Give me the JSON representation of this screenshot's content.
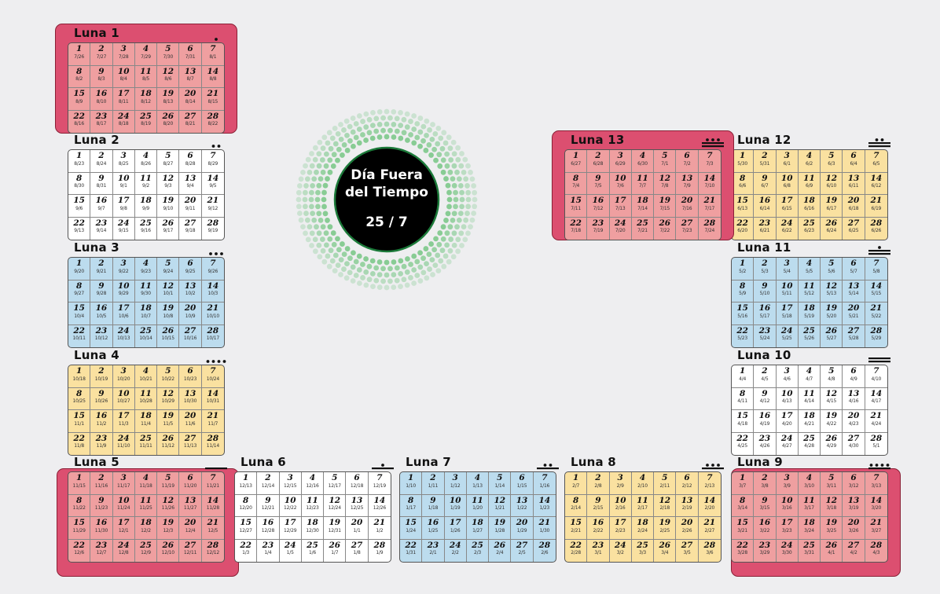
{
  "day_out_of_time": {
    "line1": "Día Fuera",
    "line2": "del Tiempo",
    "date": "25 / 7",
    "ring_color": "#7cc88a"
  },
  "moons": [
    {
      "name": "Luna 1",
      "dots": 1,
      "bars": 0,
      "color": "#ef9fa0",
      "greg": [
        "7/26",
        "7/27",
        "7/28",
        "7/29",
        "7/30",
        "7/31",
        "8/1",
        "8/2",
        "8/3",
        "8/4",
        "8/5",
        "8/6",
        "8/7",
        "8/8",
        "8/9",
        "8/10",
        "8/11",
        "8/12",
        "8/13",
        "8/14",
        "8/15",
        "8/16",
        "8/17",
        "8/18",
        "8/19",
        "8/20",
        "8/21",
        "8/22"
      ]
    },
    {
      "name": "Luna 2",
      "dots": 2,
      "bars": 0,
      "color": "#ffffff",
      "greg": [
        "8/23",
        "8/24",
        "8/25",
        "8/26",
        "8/27",
        "8/28",
        "8/29",
        "8/30",
        "8/31",
        "9/1",
        "9/2",
        "9/3",
        "9/4",
        "9/5",
        "9/6",
        "9/7",
        "9/8",
        "9/9",
        "9/10",
        "9/11",
        "9/12",
        "9/13",
        "9/14",
        "9/15",
        "9/16",
        "9/17",
        "9/18",
        "9/19"
      ]
    },
    {
      "name": "Luna 3",
      "dots": 3,
      "bars": 0,
      "color": "#bcdcee",
      "greg": [
        "9/20",
        "9/21",
        "9/22",
        "9/23",
        "9/24",
        "9/25",
        "9/26",
        "9/27",
        "9/28",
        "9/29",
        "9/30",
        "10/1",
        "10/2",
        "10/3",
        "10/4",
        "10/5",
        "10/6",
        "10/7",
        "10/8",
        "10/9",
        "10/10",
        "10/11",
        "10/12",
        "10/13",
        "10/14",
        "10/15",
        "10/16",
        "10/17"
      ]
    },
    {
      "name": "Luna 4",
      "dots": 4,
      "bars": 0,
      "color": "#fae1a0",
      "greg": [
        "10/18",
        "10/19",
        "10/20",
        "10/21",
        "10/22",
        "10/23",
        "10/24",
        "10/25",
        "10/26",
        "10/27",
        "10/28",
        "10/29",
        "10/30",
        "10/31",
        "11/1",
        "11/2",
        "11/3",
        "11/4",
        "11/5",
        "11/6",
        "11/7",
        "11/8",
        "11/9",
        "11/10",
        "11/11",
        "11/12",
        "11/13",
        "11/14"
      ]
    },
    {
      "name": "Luna 5",
      "dots": 0,
      "bars": 1,
      "color": "#ef9fa0",
      "greg": [
        "11/15",
        "11/16",
        "11/17",
        "11/18",
        "11/19",
        "11/20",
        "11/21",
        "11/22",
        "11/23",
        "11/24",
        "11/25",
        "11/26",
        "11/27",
        "11/28",
        "11/29",
        "11/30",
        "12/1",
        "12/2",
        "12/3",
        "12/4",
        "12/5",
        "12/6",
        "12/7",
        "12/8",
        "12/9",
        "12/10",
        "12/11",
        "12/12"
      ]
    },
    {
      "name": "Luna 6",
      "dots": 1,
      "bars": 1,
      "color": "#ffffff",
      "greg": [
        "12/13",
        "12/14",
        "12/15",
        "12/16",
        "12/17",
        "12/18",
        "12/19",
        "12/20",
        "12/21",
        "12/22",
        "12/23",
        "12/24",
        "12/25",
        "12/26",
        "12/27",
        "12/28",
        "12/29",
        "12/30",
        "12/31",
        "1/1",
        "1/2",
        "1/3",
        "1/4",
        "1/5",
        "1/6",
        "1/7",
        "1/8",
        "1/9"
      ]
    },
    {
      "name": "Luna 7",
      "dots": 2,
      "bars": 1,
      "color": "#bcdcee",
      "greg": [
        "1/10",
        "1/11",
        "1/12",
        "1/13",
        "1/14",
        "1/15",
        "1/16",
        "1/17",
        "1/18",
        "1/19",
        "1/20",
        "1/21",
        "1/22",
        "1/23",
        "1/24",
        "1/25",
        "1/26",
        "1/27",
        "1/28",
        "1/29",
        "1/30",
        "1/31",
        "2/1",
        "2/2",
        "2/3",
        "2/4",
        "2/5",
        "2/6"
      ]
    },
    {
      "name": "Luna 8",
      "dots": 3,
      "bars": 1,
      "color": "#fae1a0",
      "greg": [
        "2/7",
        "2/8",
        "2/9",
        "2/10",
        "2/11",
        "2/12",
        "2/13",
        "2/14",
        "2/15",
        "2/16",
        "2/17",
        "2/18",
        "2/19",
        "2/20",
        "2/21",
        "2/22",
        "2/23",
        "2/24",
        "2/25",
        "2/26",
        "2/27",
        "2/28",
        "3/1",
        "3/2",
        "3/3",
        "3/4",
        "3/5",
        "3/6"
      ]
    },
    {
      "name": "Luna 9",
      "dots": 4,
      "bars": 1,
      "color": "#ef9fa0",
      "greg": [
        "3/7",
        "3/8",
        "3/9",
        "3/10",
        "3/11",
        "3/12",
        "3/13",
        "3/14",
        "3/15",
        "3/16",
        "3/17",
        "3/18",
        "3/19",
        "3/20",
        "3/21",
        "3/22",
        "3/23",
        "3/24",
        "3/25",
        "3/26",
        "3/27",
        "3/28",
        "3/29",
        "3/30",
        "3/31",
        "4/1",
        "4/2",
        "4/3"
      ]
    },
    {
      "name": "Luna 10",
      "dots": 0,
      "bars": 2,
      "color": "#ffffff",
      "greg": [
        "4/4",
        "4/5",
        "4/6",
        "4/7",
        "4/8",
        "4/9",
        "4/10",
        "4/11",
        "4/12",
        "4/13",
        "4/14",
        "4/15",
        "4/16",
        "4/17",
        "4/18",
        "4/19",
        "4/20",
        "4/21",
        "4/22",
        "4/23",
        "4/24",
        "4/25",
        "4/26",
        "4/27",
        "4/28",
        "4/29",
        "4/30",
        "5/1"
      ]
    },
    {
      "name": "Luna 11",
      "dots": 1,
      "bars": 2,
      "color": "#bcdcee",
      "greg": [
        "5/2",
        "5/3",
        "5/4",
        "5/5",
        "5/6",
        "5/7",
        "5/8",
        "5/9",
        "5/10",
        "5/11",
        "5/12",
        "5/13",
        "5/14",
        "5/15",
        "5/16",
        "5/17",
        "5/18",
        "5/19",
        "5/20",
        "5/21",
        "5/22",
        "5/23",
        "5/24",
        "5/25",
        "5/26",
        "5/27",
        "5/28",
        "5/29"
      ]
    },
    {
      "name": "Luna 12",
      "dots": 2,
      "bars": 2,
      "color": "#fae1a0",
      "greg": [
        "5/30",
        "5/31",
        "6/1",
        "6/2",
        "6/3",
        "6/4",
        "6/5",
        "6/6",
        "6/7",
        "6/8",
        "6/9",
        "6/10",
        "6/11",
        "6/12",
        "6/13",
        "6/14",
        "6/15",
        "6/16",
        "6/17",
        "6/18",
        "6/19",
        "6/20",
        "6/21",
        "6/22",
        "6/23",
        "6/24",
        "6/25",
        "6/26"
      ]
    },
    {
      "name": "Luna 13",
      "dots": 3,
      "bars": 2,
      "color": "#ef9fa0",
      "greg": [
        "6/27",
        "6/28",
        "6/29",
        "6/30",
        "7/1",
        "7/2",
        "7/3",
        "7/4",
        "7/5",
        "7/6",
        "7/7",
        "7/8",
        "7/9",
        "7/10",
        "7/11",
        "7/12",
        "7/13",
        "7/14",
        "7/15",
        "7/16",
        "7/17",
        "7/18",
        "7/19",
        "7/20",
        "7/21",
        "7/22",
        "7/23",
        "7/24"
      ]
    }
  ]
}
